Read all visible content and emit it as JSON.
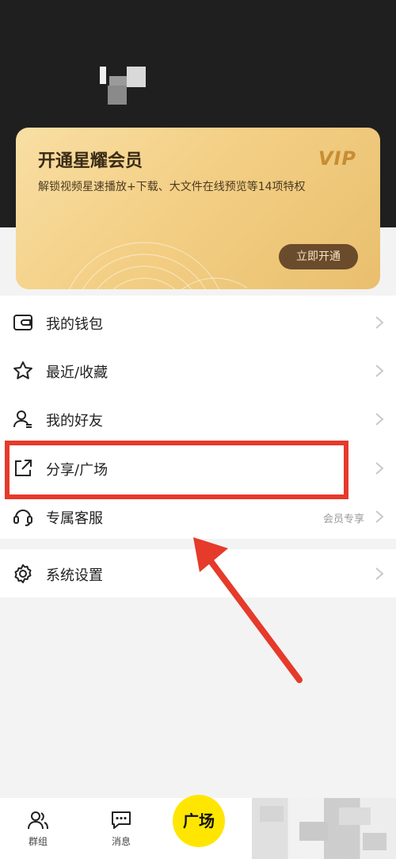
{
  "vip": {
    "title": "开通星耀会员",
    "logo": "VIP",
    "description": "解锁视频星速播放+下载、大文件在线预览等14项特权",
    "button_label": "立即开通"
  },
  "menu": {
    "items": [
      {
        "label": "我的钱包",
        "icon": "wallet-icon"
      },
      {
        "label": "最近/收藏",
        "icon": "star-icon"
      },
      {
        "label": "我的好友",
        "icon": "friends-icon"
      },
      {
        "label": "分享/广场",
        "icon": "share-icon"
      },
      {
        "label": "专属客服",
        "icon": "headset-icon",
        "badge": "会员专享"
      }
    ],
    "settings": {
      "label": "系统设置",
      "icon": "gear-icon"
    }
  },
  "bottom_nav": {
    "tabs": [
      {
        "label": "群组",
        "icon": "group-icon"
      },
      {
        "label": "消息",
        "icon": "message-icon"
      }
    ],
    "center": {
      "label": "广场"
    }
  },
  "colors": {
    "accent_yellow": "#ffe600",
    "highlight_red": "#e63a2a",
    "vip_button": "#6a4b2c"
  }
}
